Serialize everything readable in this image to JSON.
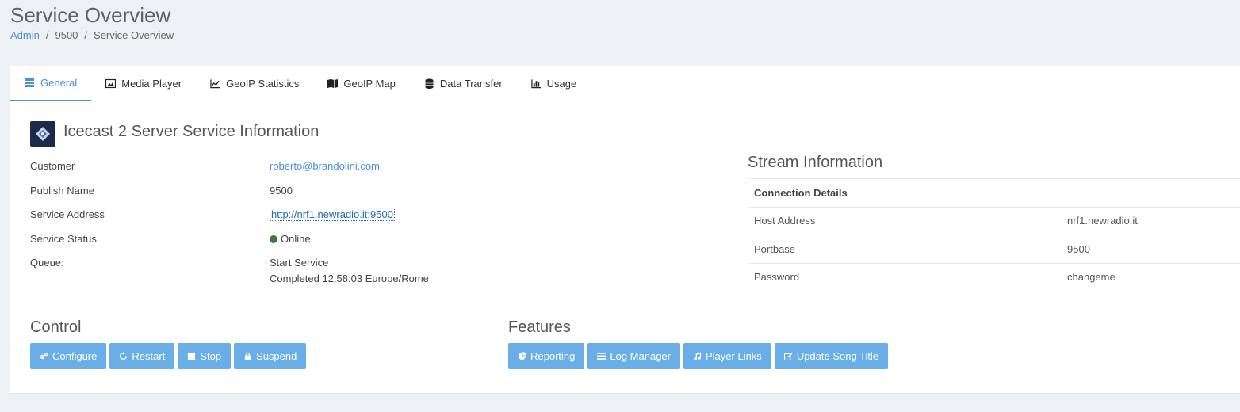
{
  "page": {
    "title": "Service Overview"
  },
  "breadcrumb": {
    "items": [
      "Admin",
      "9500",
      "Service Overview"
    ],
    "separator": "/"
  },
  "tabs": [
    {
      "label": "General",
      "icon": "server-icon",
      "active": true
    },
    {
      "label": "Media Player",
      "icon": "image-icon"
    },
    {
      "label": "GeoIP Statistics",
      "icon": "line-chart-icon"
    },
    {
      "label": "GeoIP Map",
      "icon": "map-icon"
    },
    {
      "label": "Data Transfer",
      "icon": "database-icon"
    },
    {
      "label": "Usage",
      "icon": "bar-chart-icon"
    }
  ],
  "service": {
    "title": "Icecast 2 Server Service Information",
    "rows": {
      "customer": {
        "label": "Customer",
        "value": "roberto@brandolini.com"
      },
      "publish_name": {
        "label": "Publish Name",
        "value": "9500"
      },
      "service_address": {
        "label": "Service Address",
        "value": "http://nrf1.newradio.it:9500"
      },
      "service_status": {
        "label": "Service Status",
        "value": "Online"
      },
      "queue": {
        "label": "Queue:",
        "value_line1": "Start Service",
        "value_line2": "Completed 12:58:03 Europe/Rome"
      }
    }
  },
  "stream": {
    "title": "Stream Information",
    "header": "Connection Details",
    "rows": [
      {
        "label": "Host Address",
        "value": "nrf1.newradio.it"
      },
      {
        "label": "Portbase",
        "value": "9500"
      },
      {
        "label": "Password",
        "value": "changeme"
      }
    ]
  },
  "control": {
    "title": "Control",
    "buttons": {
      "configure": "Configure",
      "restart": "Restart",
      "stop": "Stop",
      "suspend": "Suspend"
    }
  },
  "features": {
    "title": "Features",
    "buttons": {
      "reporting": "Reporting",
      "log_manager": "Log Manager",
      "player_links": "Player Links",
      "update_song_title": "Update Song Title"
    }
  },
  "colors": {
    "accent": "#4a90d9",
    "button": "#6aaee8",
    "status_online": "#3a7d3a",
    "background": "#eef1f3"
  }
}
